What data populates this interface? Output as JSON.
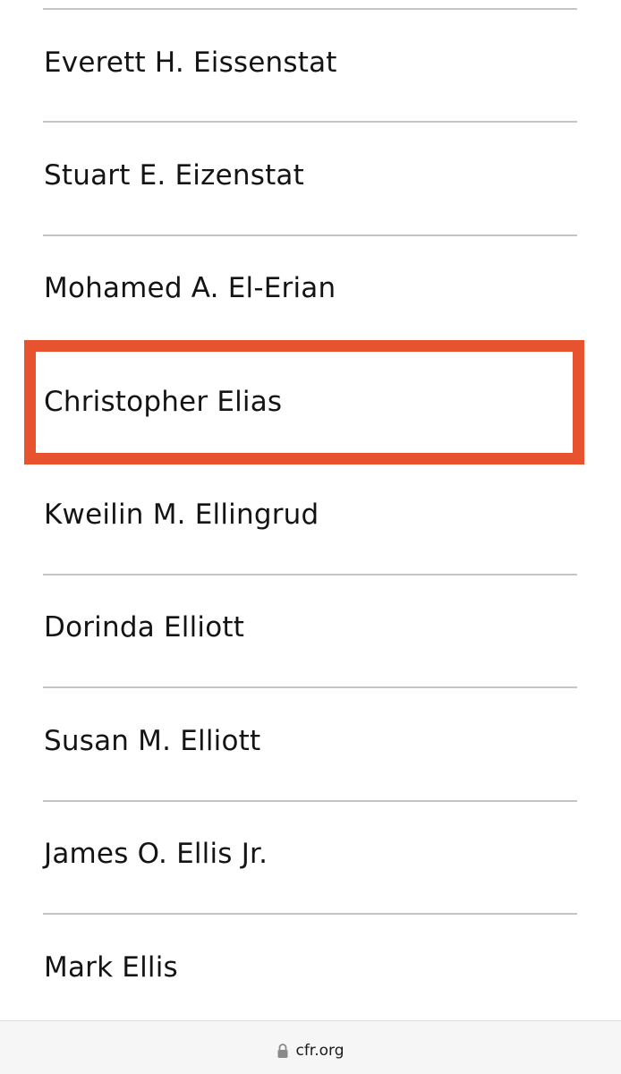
{
  "members": [
    "Everett H. Eissenstat",
    "Stuart E. Eizenstat",
    "Mohamed A. El-Erian",
    "Christopher Elias",
    "Kweilin M. Ellingrud",
    "Dorinda Elliott",
    "Susan M. Elliott",
    "James O. Ellis Jr.",
    "Mark Ellis"
  ],
  "highlighted_member": "Christopher Elias",
  "highlight_color": "#e8532f",
  "browser": {
    "url": "cfr.org",
    "lock_icon": "lock-icon"
  }
}
